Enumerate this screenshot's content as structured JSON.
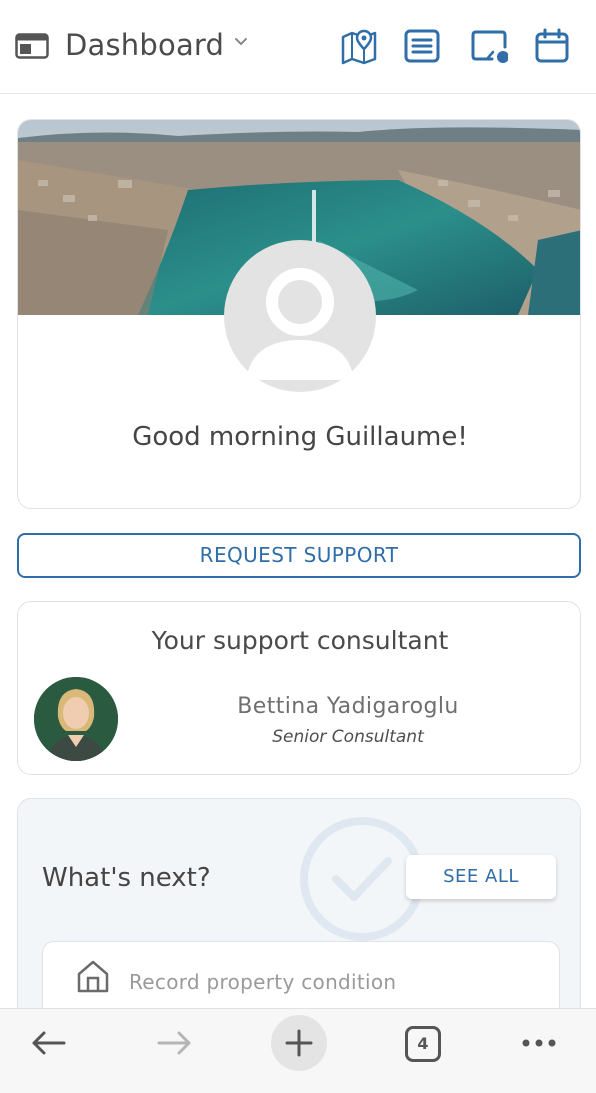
{
  "header": {
    "title": "Dashboard",
    "icons": [
      "app-window-icon",
      "map-pin-icon",
      "list-icon",
      "screen-share-icon",
      "calendar-icon"
    ],
    "accent_color": "#2f6ea8"
  },
  "profile": {
    "greeting": "Good morning Guillaume!"
  },
  "actions": {
    "request_support": "REQUEST SUPPORT"
  },
  "consultant": {
    "heading": "Your support consultant",
    "name": "Bettina Yadigaroglu",
    "role": "Senior Consultant"
  },
  "next": {
    "title": "What's next?",
    "see_all": "SEE ALL",
    "tasks": [
      {
        "label": "Record property condition",
        "icon": "house-icon"
      }
    ]
  },
  "browser_bar": {
    "tab_count": "4",
    "icons": [
      "back-arrow-icon",
      "forward-arrow-icon",
      "plus-icon",
      "tabs-icon",
      "more-icon"
    ]
  }
}
